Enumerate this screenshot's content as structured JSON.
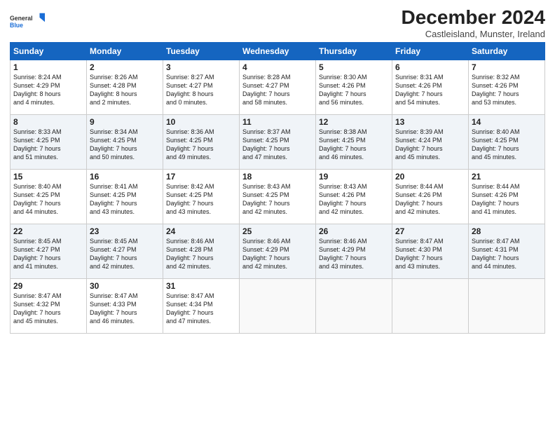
{
  "header": {
    "logo_line1": "General",
    "logo_line2": "Blue",
    "month_title": "December 2024",
    "subtitle": "Castleisland, Munster, Ireland"
  },
  "days_of_week": [
    "Sunday",
    "Monday",
    "Tuesday",
    "Wednesday",
    "Thursday",
    "Friday",
    "Saturday"
  ],
  "weeks": [
    [
      {
        "day": "1",
        "info": "Sunrise: 8:24 AM\nSunset: 4:29 PM\nDaylight: 8 hours\nand 4 minutes."
      },
      {
        "day": "2",
        "info": "Sunrise: 8:26 AM\nSunset: 4:28 PM\nDaylight: 8 hours\nand 2 minutes."
      },
      {
        "day": "3",
        "info": "Sunrise: 8:27 AM\nSunset: 4:27 PM\nDaylight: 8 hours\nand 0 minutes."
      },
      {
        "day": "4",
        "info": "Sunrise: 8:28 AM\nSunset: 4:27 PM\nDaylight: 7 hours\nand 58 minutes."
      },
      {
        "day": "5",
        "info": "Sunrise: 8:30 AM\nSunset: 4:26 PM\nDaylight: 7 hours\nand 56 minutes."
      },
      {
        "day": "6",
        "info": "Sunrise: 8:31 AM\nSunset: 4:26 PM\nDaylight: 7 hours\nand 54 minutes."
      },
      {
        "day": "7",
        "info": "Sunrise: 8:32 AM\nSunset: 4:26 PM\nDaylight: 7 hours\nand 53 minutes."
      }
    ],
    [
      {
        "day": "8",
        "info": "Sunrise: 8:33 AM\nSunset: 4:25 PM\nDaylight: 7 hours\nand 51 minutes."
      },
      {
        "day": "9",
        "info": "Sunrise: 8:34 AM\nSunset: 4:25 PM\nDaylight: 7 hours\nand 50 minutes."
      },
      {
        "day": "10",
        "info": "Sunrise: 8:36 AM\nSunset: 4:25 PM\nDaylight: 7 hours\nand 49 minutes."
      },
      {
        "day": "11",
        "info": "Sunrise: 8:37 AM\nSunset: 4:25 PM\nDaylight: 7 hours\nand 47 minutes."
      },
      {
        "day": "12",
        "info": "Sunrise: 8:38 AM\nSunset: 4:25 PM\nDaylight: 7 hours\nand 46 minutes."
      },
      {
        "day": "13",
        "info": "Sunrise: 8:39 AM\nSunset: 4:24 PM\nDaylight: 7 hours\nand 45 minutes."
      },
      {
        "day": "14",
        "info": "Sunrise: 8:40 AM\nSunset: 4:25 PM\nDaylight: 7 hours\nand 45 minutes."
      }
    ],
    [
      {
        "day": "15",
        "info": "Sunrise: 8:40 AM\nSunset: 4:25 PM\nDaylight: 7 hours\nand 44 minutes."
      },
      {
        "day": "16",
        "info": "Sunrise: 8:41 AM\nSunset: 4:25 PM\nDaylight: 7 hours\nand 43 minutes."
      },
      {
        "day": "17",
        "info": "Sunrise: 8:42 AM\nSunset: 4:25 PM\nDaylight: 7 hours\nand 43 minutes."
      },
      {
        "day": "18",
        "info": "Sunrise: 8:43 AM\nSunset: 4:25 PM\nDaylight: 7 hours\nand 42 minutes."
      },
      {
        "day": "19",
        "info": "Sunrise: 8:43 AM\nSunset: 4:26 PM\nDaylight: 7 hours\nand 42 minutes."
      },
      {
        "day": "20",
        "info": "Sunrise: 8:44 AM\nSunset: 4:26 PM\nDaylight: 7 hours\nand 42 minutes."
      },
      {
        "day": "21",
        "info": "Sunrise: 8:44 AM\nSunset: 4:26 PM\nDaylight: 7 hours\nand 41 minutes."
      }
    ],
    [
      {
        "day": "22",
        "info": "Sunrise: 8:45 AM\nSunset: 4:27 PM\nDaylight: 7 hours\nand 41 minutes."
      },
      {
        "day": "23",
        "info": "Sunrise: 8:45 AM\nSunset: 4:27 PM\nDaylight: 7 hours\nand 42 minutes."
      },
      {
        "day": "24",
        "info": "Sunrise: 8:46 AM\nSunset: 4:28 PM\nDaylight: 7 hours\nand 42 minutes."
      },
      {
        "day": "25",
        "info": "Sunrise: 8:46 AM\nSunset: 4:29 PM\nDaylight: 7 hours\nand 42 minutes."
      },
      {
        "day": "26",
        "info": "Sunrise: 8:46 AM\nSunset: 4:29 PM\nDaylight: 7 hours\nand 43 minutes."
      },
      {
        "day": "27",
        "info": "Sunrise: 8:47 AM\nSunset: 4:30 PM\nDaylight: 7 hours\nand 43 minutes."
      },
      {
        "day": "28",
        "info": "Sunrise: 8:47 AM\nSunset: 4:31 PM\nDaylight: 7 hours\nand 44 minutes."
      }
    ],
    [
      {
        "day": "29",
        "info": "Sunrise: 8:47 AM\nSunset: 4:32 PM\nDaylight: 7 hours\nand 45 minutes."
      },
      {
        "day": "30",
        "info": "Sunrise: 8:47 AM\nSunset: 4:33 PM\nDaylight: 7 hours\nand 46 minutes."
      },
      {
        "day": "31",
        "info": "Sunrise: 8:47 AM\nSunset: 4:34 PM\nDaylight: 7 hours\nand 47 minutes."
      },
      null,
      null,
      null,
      null
    ]
  ]
}
